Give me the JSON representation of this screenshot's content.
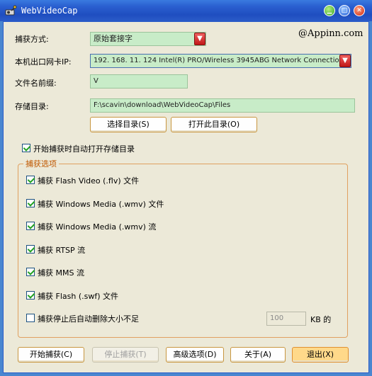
{
  "window": {
    "title": "WebVideoCap",
    "brand": "@Appinn.com"
  },
  "capture_mode": {
    "label": "捕获方式:",
    "value": "原始套接字"
  },
  "nic": {
    "label": "本机出口网卡IP:",
    "value": "192. 168. 11. 124   Intel(R) PRO/Wireless 3945ABG Network Connection - "
  },
  "prefix": {
    "label": "文件名前缀:",
    "value": "V"
  },
  "storage": {
    "label": "存储目录:",
    "value": "F:\\scavin\\download\\WebVideoCap\\Files",
    "select_button": "选择目录(S)",
    "open_button": "打开此目录(O)"
  },
  "auto_open": {
    "label": "开始捕获时自动打开存储目录",
    "checked": true
  },
  "options": {
    "title": "捕获选项",
    "items": [
      {
        "label": "捕获 Flash Video (.flv) 文件",
        "checked": true
      },
      {
        "label": "捕获 Windows Media (.wmv) 文件",
        "checked": true
      },
      {
        "label": "捕获 Windows Media (.wmv) 流",
        "checked": true
      },
      {
        "label": "捕获 RTSP 流",
        "checked": true
      },
      {
        "label": "捕获 MMS 流",
        "checked": true
      },
      {
        "label": "捕获 Flash (.swf) 文件",
        "checked": true
      },
      {
        "label": "捕获停止后自动删除大小不足",
        "checked": false
      }
    ],
    "min_size": "100",
    "min_size_unit": "KB 的"
  },
  "buttons": {
    "start": "开始捕获(C)",
    "stop": "停止捕获(T)",
    "advanced": "高级选项(D)",
    "about": "关于(A)",
    "exit": "退出(X)"
  }
}
